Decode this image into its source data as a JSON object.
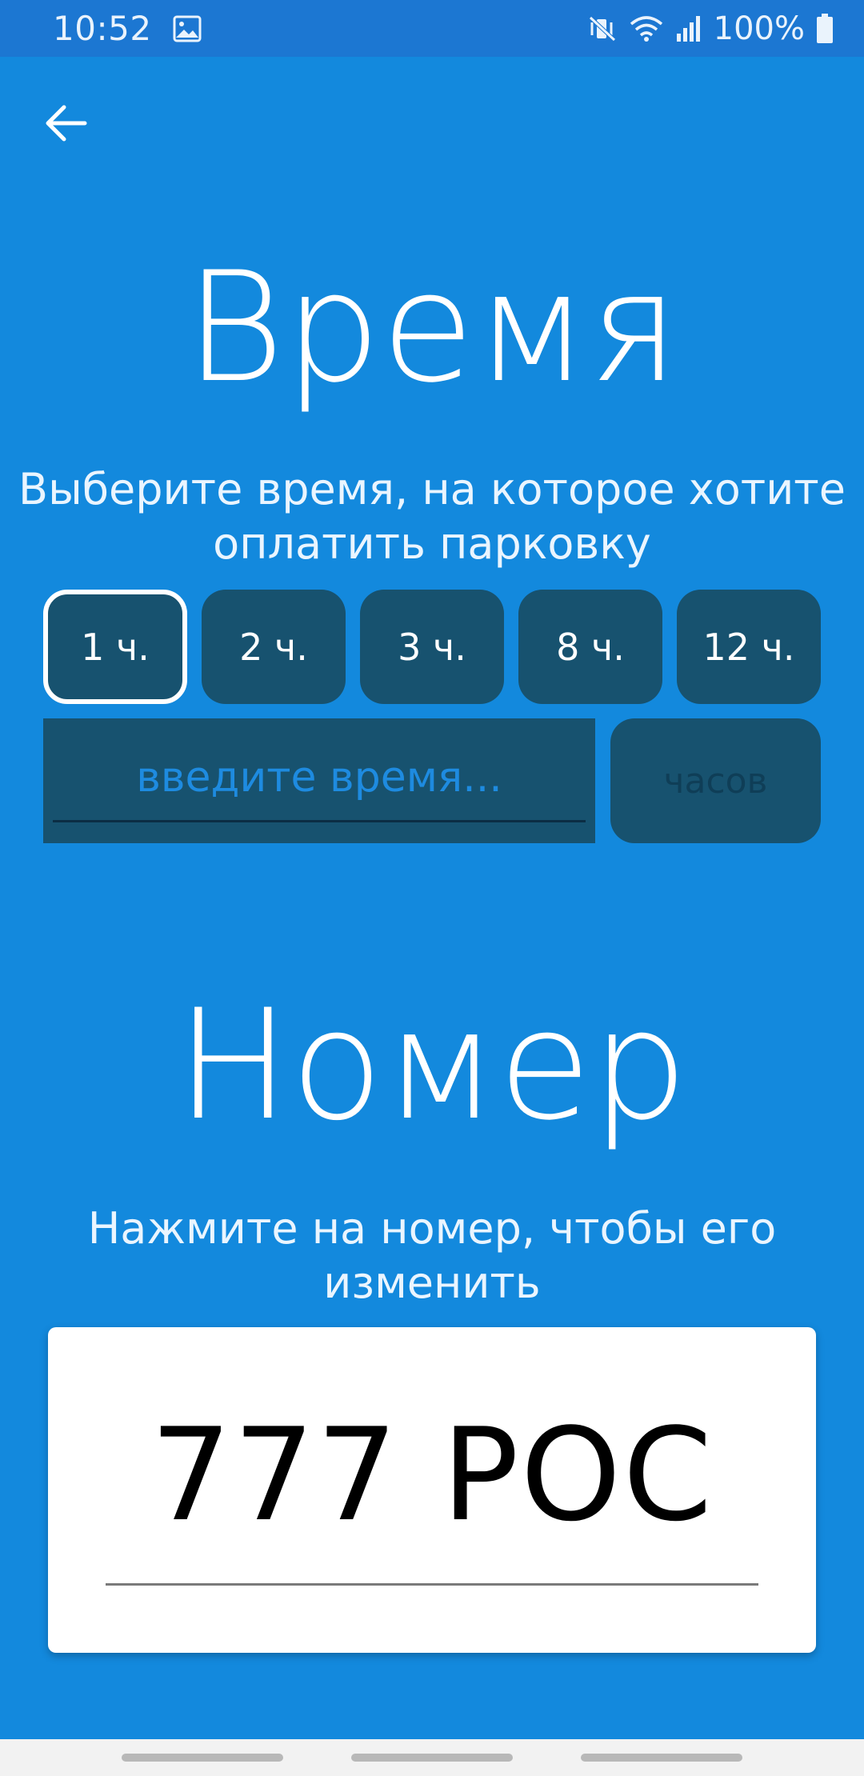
{
  "status_bar": {
    "time": "10:52",
    "battery": "100%",
    "icons": [
      "image-icon",
      "vibrate-icon",
      "wifi-icon",
      "signal-icon",
      "battery-icon"
    ]
  },
  "toolbar": {
    "back_icon": "arrow-left-icon"
  },
  "time_section": {
    "title": "Время",
    "subtitle": "Выберите время, на которое хотите оплатить парковку",
    "options": [
      {
        "label": "1 ч.",
        "selected": true
      },
      {
        "label": "2 ч.",
        "selected": false
      },
      {
        "label": "3 ч.",
        "selected": false
      },
      {
        "label": "8 ч.",
        "selected": false
      },
      {
        "label": "12 ч.",
        "selected": false
      }
    ],
    "custom_input": {
      "value": "",
      "placeholder": "введите время..."
    },
    "unit_label": "часов"
  },
  "number_section": {
    "title": "Номер",
    "subtitle": "Нажмите на номер, чтобы его изменить",
    "plate": "777 РОС"
  },
  "colors": {
    "background": "#1389DD",
    "status_bar": "#1C77D2",
    "button": "#17526F",
    "card": "#FFFFFF"
  }
}
